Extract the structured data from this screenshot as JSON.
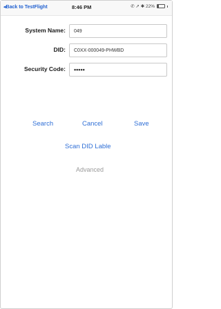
{
  "status_bar": {
    "back_label": "◂Back to TestFlight",
    "time": "8:46 PM",
    "indicators": "✆ ➚ ✱ 22%",
    "battery_level": 0.22
  },
  "form": {
    "system_name": {
      "label": "System Name:",
      "value": "049"
    },
    "did": {
      "label": "DID:",
      "value": "C0XX-000049-PHWBD"
    },
    "security_code": {
      "label": "Security Code:",
      "value": "•••••"
    }
  },
  "actions": {
    "search_label": "Search",
    "cancel_label": "Cancel",
    "save_label": "Save",
    "scan_label": "Scan DID Lable",
    "advanced_label": "Advanced"
  },
  "colors": {
    "link": "#2f6fd6",
    "disabled": "#9a9a9a",
    "back_link": "#1f5fd0"
  }
}
